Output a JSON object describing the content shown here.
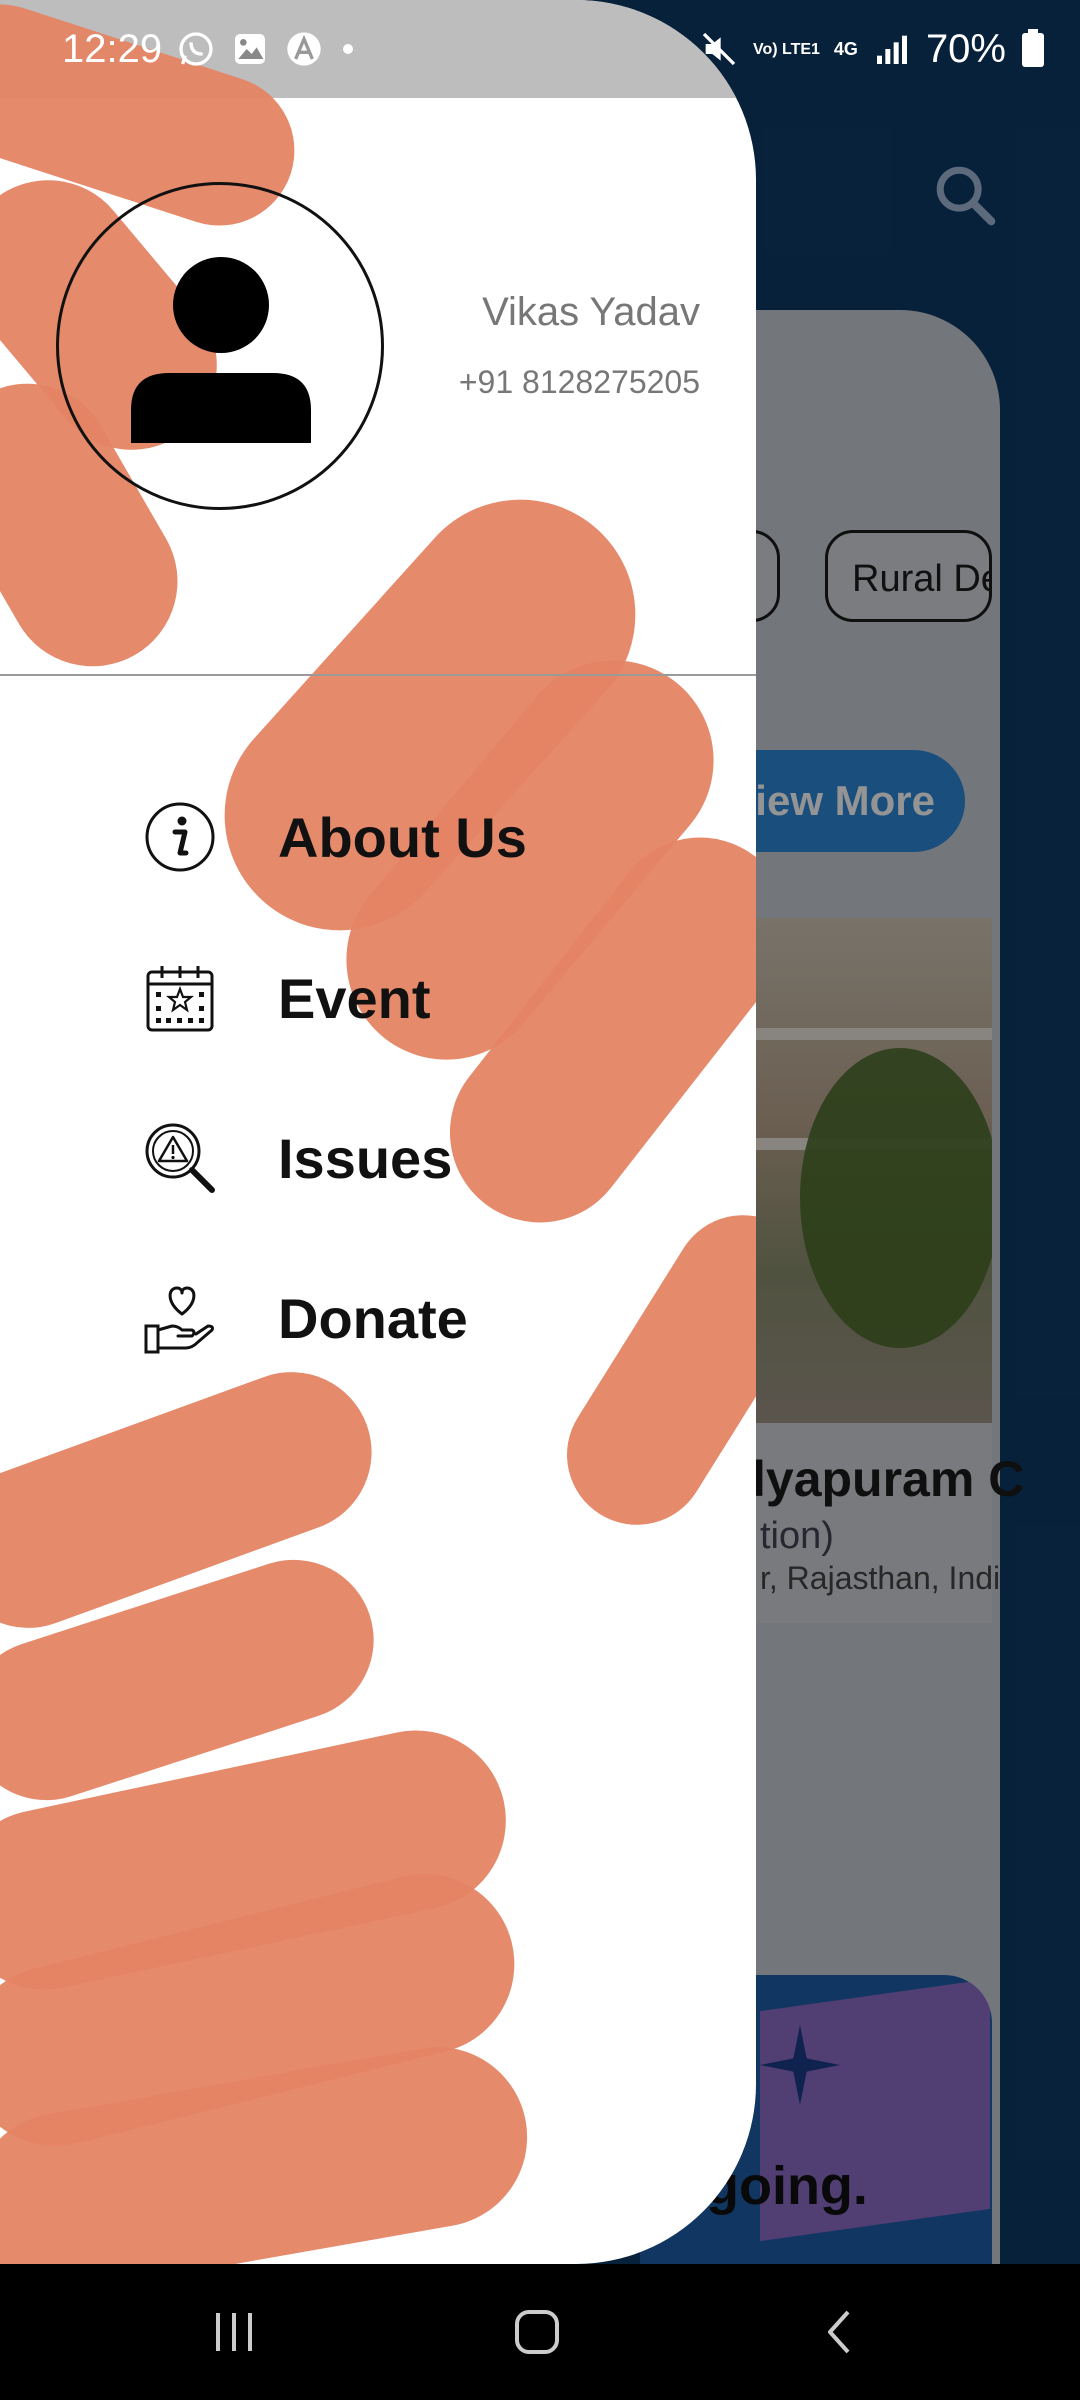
{
  "status_bar": {
    "time": "12:29",
    "battery": "70%",
    "network": "4G",
    "volte": "Vo) LTE1",
    "notification_icons": [
      "whatsapp-icon",
      "gallery-icon",
      "app-icon",
      "dot-icon"
    ],
    "system_icons": [
      "mute-icon",
      "volte-icon",
      "data-arrows-icon",
      "signal-icon",
      "battery-icon"
    ]
  },
  "drawer": {
    "user": {
      "name": "Vikas Yadav",
      "phone": "+91 8128275205"
    },
    "menu": [
      {
        "label": "About Us",
        "icon": "info-icon"
      },
      {
        "label": "Event",
        "icon": "calendar-icon"
      },
      {
        "label": "Issues",
        "icon": "warning-search-icon"
      },
      {
        "label": "Donate",
        "icon": "donate-heart-hand-icon"
      }
    ]
  },
  "background_page": {
    "chips": [
      "",
      "Rural De"
    ],
    "view_more": "View More",
    "project_title": "lyapuram C",
    "project_subtitle": "tion)",
    "project_location": "r, Rajasthan, Indi",
    "banner_text": "ongoing."
  },
  "colors": {
    "drawer_bg": "#ffffff",
    "paint_stroke": "#e58464",
    "background_primary": "#0e3a66",
    "view_more_button": "#2c87d8"
  }
}
